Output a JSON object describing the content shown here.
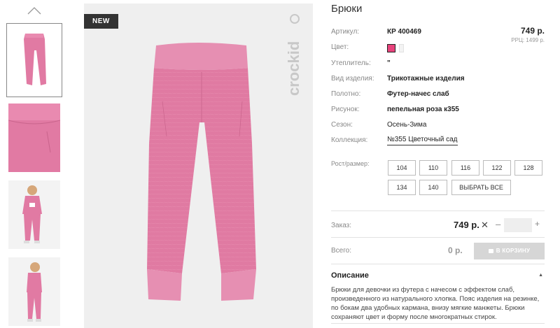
{
  "badge": "NEW",
  "brand": "crockid",
  "product": {
    "title": "Брюки",
    "price": "749 р.",
    "rrp": "РРЦ: 1499 р."
  },
  "attributes": [
    {
      "label": "Артикул:",
      "value": "КР 400469",
      "style": "bold"
    },
    {
      "label": "Цвет:",
      "value": "",
      "style": "swatch"
    },
    {
      "label": "Утеплитель:",
      "value": "\"",
      "style": "bold"
    },
    {
      "label": "Вид изделия:",
      "value": "Трикотажные изделия",
      "style": "bold"
    },
    {
      "label": "Полотно:",
      "value": "Футер-начес слаб",
      "style": "bold"
    },
    {
      "label": "Рисунок:",
      "value": "пепельная роза к355",
      "style": "bold"
    },
    {
      "label": "Сезон:",
      "value": "Осень-Зима",
      "style": "normal"
    },
    {
      "label": "Коллекция:",
      "value": "№355 Цветочный сад",
      "style": "link"
    }
  ],
  "colors": {
    "selected": "#e8437c",
    "accent_pink": "#e17aa3"
  },
  "sizes": {
    "label": "Рост/размер:",
    "options": [
      "104",
      "110",
      "116",
      "122",
      "128",
      "134",
      "140"
    ],
    "select_all": "ВЫБРАТЬ ВСЕ"
  },
  "order": {
    "label": "Заказ:",
    "price": "749 р.",
    "clear_icon": "✕",
    "minus": "–",
    "plus": "+",
    "quantity": ""
  },
  "total": {
    "label": "Всего:",
    "value": "0 р.",
    "cart_button": "В КОРЗИНУ"
  },
  "description": {
    "heading": "Описание",
    "text": "Брюки для девочки из футера с начесом с эффектом слаб, произведенного из натурального хлопка. Пояс изделия на резинке, по бокам два удобных кармана, внизу мягкие манжеты. Брюки сохраняют цвет и форму после многократных стирок."
  }
}
